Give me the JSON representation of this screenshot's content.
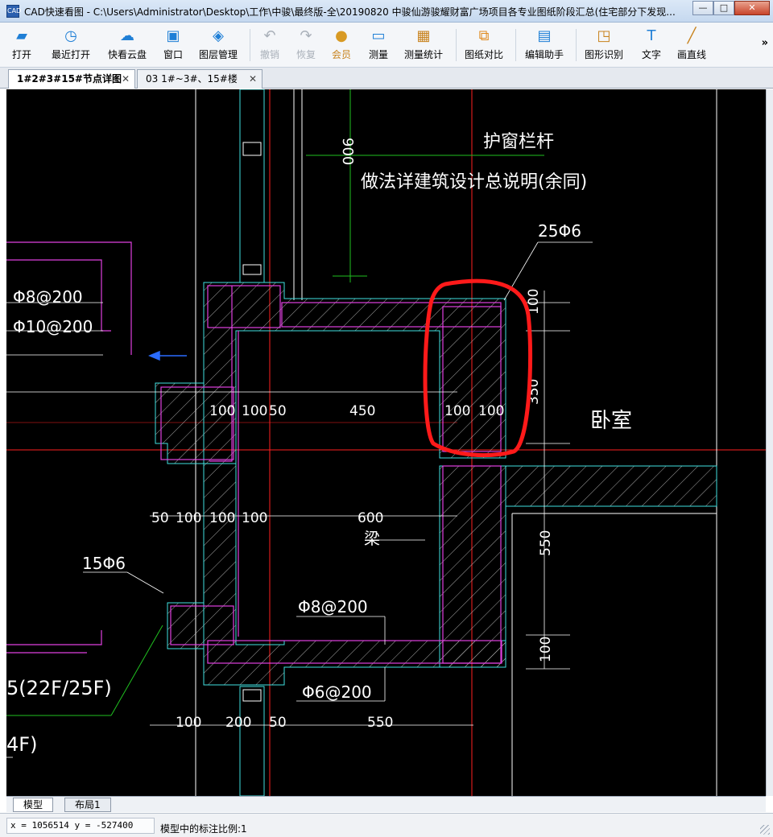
{
  "window": {
    "title": "CAD快速看图 - C:\\Users\\Administrator\\Desktop\\工作\\中骏\\最终版-全\\20190820 中骏仙游骏耀财富广场项目各专业图纸阶段汇总(住宅部分下发现...",
    "minimize": "—",
    "restore": "□",
    "close": "✕"
  },
  "toolbar": {
    "items": [
      {
        "label": "打开",
        "icon": "folder-open-icon"
      },
      {
        "label": "最近打开",
        "icon": "recent-clock-icon"
      },
      {
        "label": "快看云盘",
        "icon": "cloud-icon"
      },
      {
        "label": "窗口",
        "icon": "window-icon"
      },
      {
        "label": "图层管理",
        "icon": "layers-icon"
      },
      {
        "label": "撤销",
        "icon": "undo-icon"
      },
      {
        "label": "恢复",
        "icon": "redo-icon"
      },
      {
        "label": "会员",
        "icon": "vip-icon"
      },
      {
        "label": "测量",
        "icon": "ruler-icon"
      },
      {
        "label": "测量统计",
        "icon": "measure-stats-icon"
      },
      {
        "label": "图纸对比",
        "icon": "compare-icon"
      },
      {
        "label": "编辑助手",
        "icon": "edit-helper-icon"
      },
      {
        "label": "图形识别",
        "icon": "shape-recognize-icon"
      },
      {
        "label": "文字",
        "icon": "text-icon"
      },
      {
        "label": "画直线",
        "icon": "line-icon"
      }
    ],
    "more": "»"
  },
  "tabs": [
    {
      "label": "1#2#3#15#节点详图",
      "active": true,
      "close": "✕"
    },
    {
      "label": "03 1#~3#、15#楼",
      "active": false,
      "close": "✕"
    }
  ],
  "drawing": {
    "labels": {
      "dim_900": "900",
      "rail_note": "护窗栏杆",
      "rail_note2": "做法详建筑设计总说明(余同)",
      "rebar_25": "25Φ6",
      "rebar_phi8_left": "Φ8@200",
      "rebar_phi10_left": "Φ10@200",
      "dim_100_r1": "100",
      "dim_350": "350",
      "bedroom": "卧室",
      "d100a": "100",
      "d100b": "100",
      "d50a": "50",
      "d450": "450",
      "d100c": "100",
      "d100d": "100",
      "d50b": "50",
      "d100e": "100",
      "d100f": "100",
      "d100g": "100",
      "d600": "600",
      "beam": "梁",
      "d550v": "550",
      "rebar_15": "15Φ6",
      "rebar_phi8_bottom": "Φ8@200",
      "d100v": "100",
      "floor_note": "5(22F/25F)",
      "rebar_phi6": "Φ6@200",
      "d100h": "100",
      "d200": "200",
      "d50c": "50",
      "d550": "550",
      "floor_note2": "4F)"
    }
  },
  "layout_tabs": [
    {
      "label": "模型",
      "active": true
    },
    {
      "label": "布局1",
      "active": false
    }
  ],
  "status": {
    "coords": "x = 1056514  y = -527400",
    "scale": "模型中的标注比例:1"
  },
  "colors": {
    "canvas_bg": "#000000",
    "magenta": "#e040e0",
    "cyan": "#40e0e0",
    "red": "#ff2020",
    "green": "#20c020",
    "white": "#ffffff",
    "highlight": "#ff1a1a"
  }
}
